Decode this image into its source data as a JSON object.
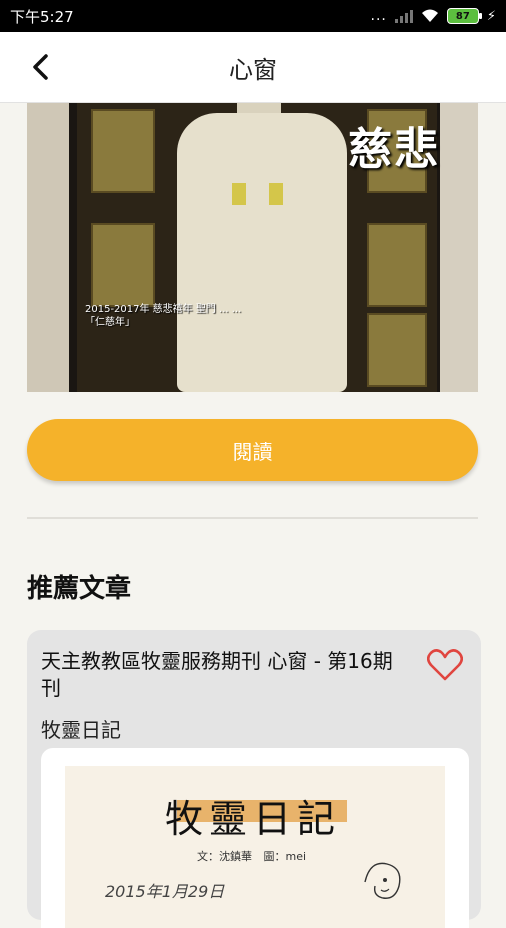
{
  "status_bar": {
    "time": "下午5:27",
    "dots": "...",
    "battery": "87"
  },
  "header": {
    "title": "心窗"
  },
  "cover": {
    "title": "慈悲",
    "caption": "2015-2017年 慈悲禧年 聖門 ... ... 「仁慈年」"
  },
  "read_button": {
    "label": "閱讀"
  },
  "recommended": {
    "section_title": "推薦文章",
    "articles": [
      {
        "title": "天主教教區牧靈服務期刊  心窗 - 第16期刊",
        "subtitle": "牧靈日記",
        "image": {
          "handwritten_title": "牧靈日記",
          "byline": "文：沈鎮華   圖：mei",
          "date": "2015年1月29日"
        },
        "favorite_icon": "heart-outline-icon"
      }
    ]
  },
  "colors": {
    "accent": "#f5b22a",
    "heart": "#e0453f"
  }
}
